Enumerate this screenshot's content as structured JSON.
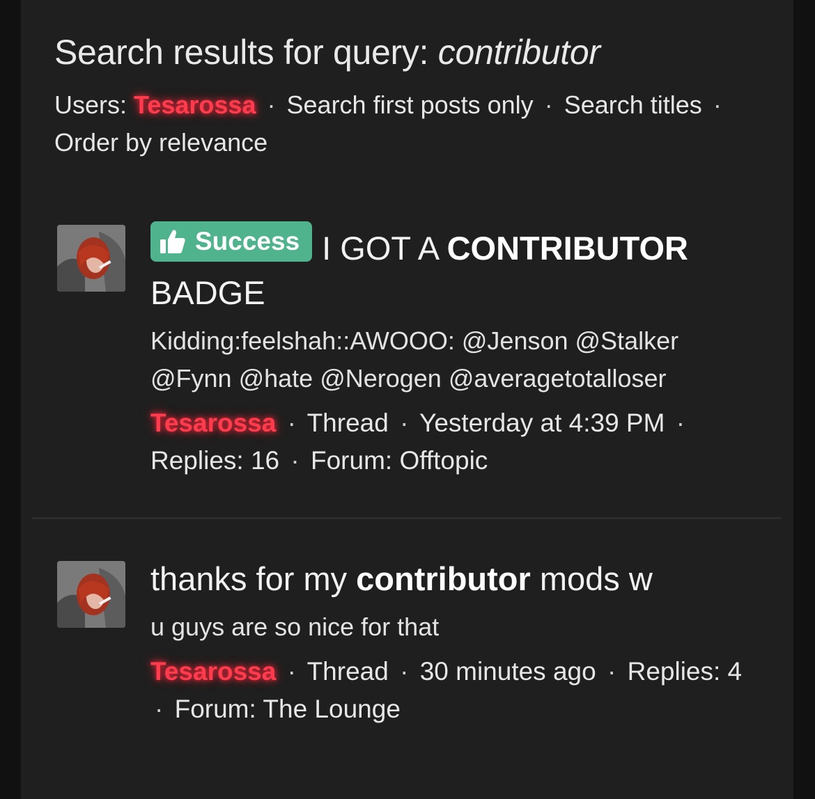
{
  "header": {
    "title_prefix": "Search results for query:",
    "query": "contributor",
    "filters": {
      "users_label": "Users:",
      "user": "Tesarossa",
      "first_posts": "Search first posts only",
      "titles": "Search titles",
      "order": "Order by relevance"
    }
  },
  "separator": "·",
  "results": [
    {
      "prefix": "Success",
      "prefix_color": "#4fb38e",
      "title_before": "I GOT A",
      "title_highlight": "CONTRIBUTOR",
      "title_after": "BADGE",
      "snippet": "Kidding:feelshah::AWOOO: @Jenson @Stalker @Fynn @hate @Nerogen @averagetotalloser",
      "author": "Tesarossa",
      "type": "Thread",
      "time": "Yesterday at 4:39 PM",
      "replies": "Replies: 16",
      "forum": "Forum: Offtopic"
    },
    {
      "title_before": "thanks for my",
      "title_highlight": "contributor",
      "title_after": "mods w",
      "snippet": "u guys are so nice for that",
      "author": "Tesarossa",
      "type": "Thread",
      "time": "30 minutes ago",
      "replies": "Replies: 4",
      "forum": "Forum: The Lounge"
    }
  ],
  "colors": {
    "background": "#1f1f1f",
    "username": "#ff3b4e",
    "prefix_success": "#4fb38e"
  }
}
